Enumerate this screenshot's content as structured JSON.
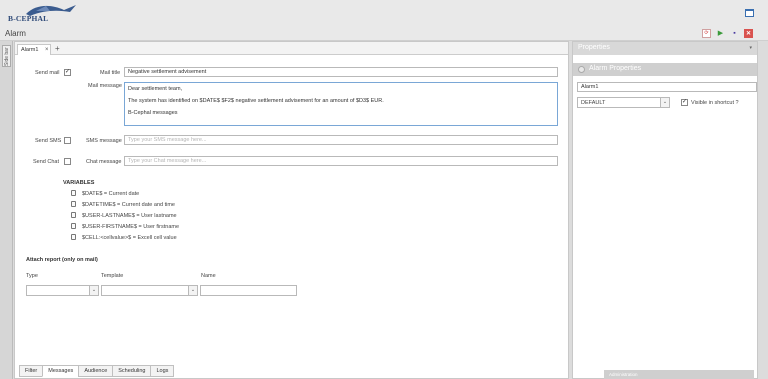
{
  "app": {
    "logo_text": "B-CEPHAL",
    "page_title": "Alarm",
    "toolbar": {
      "refresh_glyph": "⟳",
      "run_glyph": "▶",
      "save_glyph": "▪",
      "close_glyph": "✕"
    }
  },
  "sidebar": {
    "tab_label": "Side bar"
  },
  "editor": {
    "tabs": [
      {
        "label": "Alarm1",
        "close": "×"
      }
    ],
    "add_tab": "+",
    "send_mail": {
      "label": "Send mail",
      "checked": true,
      "check_glyph": "✓"
    },
    "mail_title": {
      "label": "Mail title",
      "value": "Negative settlement advisement"
    },
    "mail_message": {
      "label": "Mail message",
      "lines": [
        "Dear settlement team,",
        "The system has identified on $DATE$ $F2$ negative settlement advisement for an amount of $D3$ EUR.",
        "B-Cephal messages"
      ]
    },
    "send_sms": {
      "label": "Send SMS",
      "checked": false
    },
    "sms_message": {
      "label": "SMS message",
      "placeholder": "Type your SMS message here..."
    },
    "send_chat": {
      "label": "Send Chat",
      "checked": false
    },
    "chat_message": {
      "label": "Chat message",
      "placeholder": "Type your Chat message here..."
    },
    "variables": {
      "title": "VARIABLES",
      "items": [
        "$DATE$ = Current date",
        "$DATETIME$ = Current date and time",
        "$USER-LASTNAME$ = User lastname",
        "$USER-FIRSTNAME$ = User firstname",
        "$CELL:<cellvalue>$ = Excell cell value"
      ]
    },
    "attach_report": {
      "title": "Attach report (only on mail)",
      "type_label": "Type",
      "template_label": "Template",
      "name_label": "Name",
      "dropdown_glyph": "⌄"
    },
    "bottom_tabs": [
      "Filter",
      "Messages",
      "Audience",
      "Scheduling",
      "Logs"
    ],
    "active_bottom_tab": "Messages"
  },
  "properties": {
    "header": "Properties",
    "pin_glyph": "▾",
    "section_title": "Alarm Properties",
    "name_value": "Alarm1",
    "group_value": "DEFAULT",
    "visible_in_shortcut": {
      "label": "Visible in shortcut ?",
      "checked": true,
      "check_glyph": "✓"
    },
    "footer": "Administration"
  }
}
